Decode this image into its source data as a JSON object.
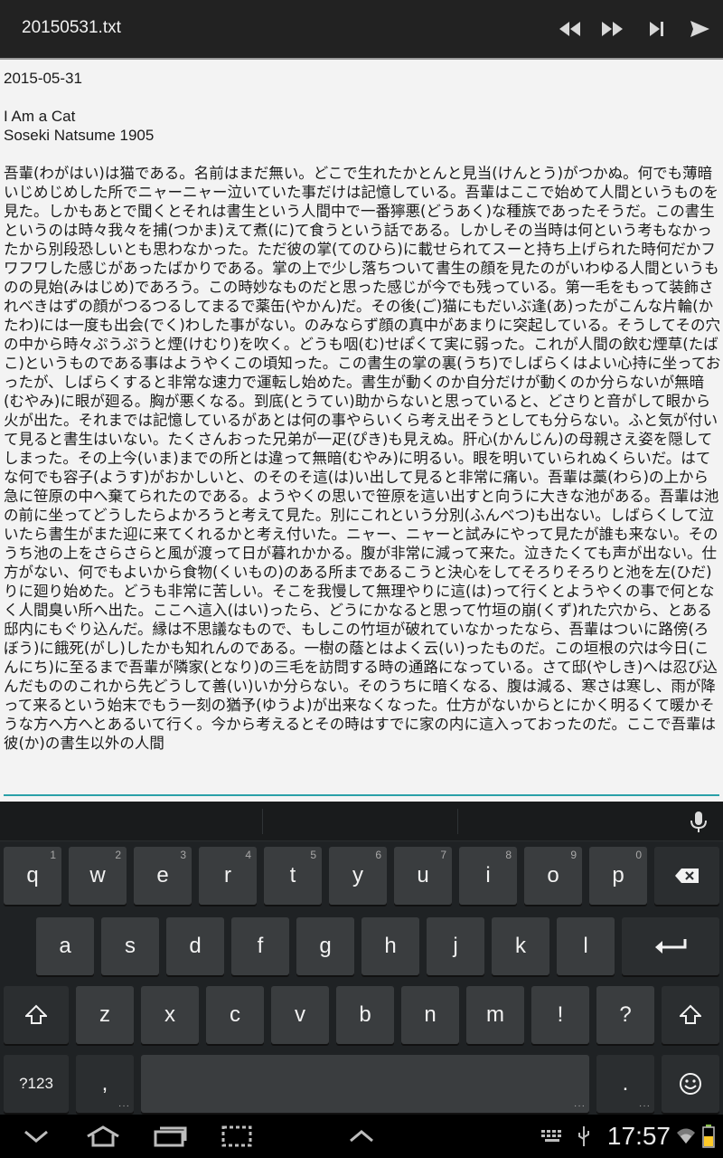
{
  "actionbar": {
    "title": "20150531.txt",
    "buttons": [
      "rewind-icon",
      "fast-forward-icon",
      "skip-next-icon",
      "send-icon"
    ]
  },
  "editor": {
    "date": "2015-05-31",
    "title_line1": "I Am a Cat",
    "title_line2": "Soseki Natsume 1905",
    "body": "吾輩(わがはい)は猫である。名前はまだ無い。どこで生れたかとんと見当(けんとう)がつかぬ。何でも薄暗いじめじめした所でニャーニャー泣いていた事だけは記憶している。吾輩はここで始めて人間というものを見た。しかもあとで聞くとそれは書生という人間中で一番獰悪(どうあく)な種族であったそうだ。この書生というのは時々我々を捕(つかま)えて煮(に)て食うという話である。しかしその当時は何という考もなかったから別段恐しいとも思わなかった。ただ彼の掌(てのひら)に載せられてスーと持ち上げられた時何だかフワフワした感じがあったばかりである。掌の上で少し落ちついて書生の顔を見たのがいわゆる人間というものの見始(みはじめ)であろう。この時妙なものだと思った感じが今でも残っている。第一毛をもって装飾されべきはずの顔がつるつるしてまるで薬缶(やかん)だ。その後(ご)猫にもだいぶ逢(あ)ったがこんな片輪(かたわ)には一度も出会(でく)わした事がない。のみならず顔の真中があまりに突起している。そうしてその穴の中から時々ぷうぷうと煙(けむり)を吹く。どうも咽(む)せぽくて実に弱った。これが人間の飲む煙草(たばこ)というものである事はようやくこの頃知った。この書生の掌の裏(うち)でしばらくはよい心持に坐っておったが、しばらくすると非常な速力で運転し始めた。書生が動くのか自分だけが動くのか分らないが無暗(むやみ)に眼が廻る。胸が悪くなる。到底(とうてい)助からないと思っていると、どさりと音がして眼から火が出た。それまでは記憶しているがあとは何の事やらいくら考え出そうとしても分らない。ふと気が付いて見ると書生はいない。たくさんおった兄弟が一疋(ぴき)も見えぬ。肝心(かんじん)の母親さえ姿を隠してしまった。その上今(いま)までの所とは違って無暗(むやみ)に明るい。眼を明いていられぬくらいだ。はてな何でも容子(ようす)がおかしいと、のそのそ這(は)い出して見ると非常に痛い。吾輩は藁(わら)の上から急に笹原の中へ棄てられたのである。ようやくの思いで笹原を這い出すと向うに大きな池がある。吾輩は池の前に坐ってどうしたらよかろうと考えて見た。別にこれという分別(ふんべつ)も出ない。しばらくして泣いたら書生がまた迎に来てくれるかと考え付いた。ニャー、ニャーと試みにやって見たが誰も来ない。そのうち池の上をさらさらと風が渡って日が暮れかかる。腹が非常に減って来た。泣きたくても声が出ない。仕方がない、何でもよいから食物(くいもの)のある所まであるこうと決心をしてそろりそろりと池を左(ひだ)りに廻り始めた。どうも非常に苦しい。そこを我慢して無理やりに這(は)って行くとようやくの事で何となく人間臭い所へ出た。ここへ這入(はい)ったら、どうにかなると思って竹垣の崩(くず)れた穴から、とある邸内にもぐり込んだ。縁は不思議なもので、もしこの竹垣が破れていなかったなら、吾輩はついに路傍(ろぼう)に餓死(がし)したかも知れんのである。一樹の蔭とはよく云(い)ったものだ。この垣根の穴は今日(こんにち)に至るまで吾輩が隣家(となり)の三毛を訪問する時の通路になっている。さて邸(やしき)へは忍び込んだもののこれから先どうして善(い)いか分らない。そのうちに暗くなる、腹は減る、寒さは寒し、雨が降って来るという始末でもう一刻の猶予(ゆうよ)が出来なくなった。仕方がないからとにかく明るくて暖かそうな方へ方へとあるいて行く。今から考えるとその時はすでに家の内に這入っておったのだ。ここで吾輩は彼(か)の書生以外の人間"
  },
  "keyboard": {
    "row1": [
      {
        "label": "q",
        "hint": "1"
      },
      {
        "label": "w",
        "hint": "2"
      },
      {
        "label": "e",
        "hint": "3"
      },
      {
        "label": "r",
        "hint": "4"
      },
      {
        "label": "t",
        "hint": "5"
      },
      {
        "label": "y",
        "hint": "6"
      },
      {
        "label": "u",
        "hint": "7"
      },
      {
        "label": "i",
        "hint": "8"
      },
      {
        "label": "o",
        "hint": "9"
      },
      {
        "label": "p",
        "hint": "0"
      }
    ],
    "row2": [
      "a",
      "s",
      "d",
      "f",
      "g",
      "h",
      "j",
      "k",
      "l"
    ],
    "row3": [
      "z",
      "x",
      "c",
      "v",
      "b",
      "n",
      "m",
      "!",
      "?"
    ],
    "symbols_label": "?123",
    "comma_label": ",",
    "period_label": ".",
    "icons": [
      "mic-icon",
      "backspace-icon",
      "enter-icon",
      "shift-icon",
      "emoji-icon"
    ]
  },
  "navbar": {
    "clock": "17:57",
    "icons": [
      "back-icon",
      "home-icon",
      "recents-icon",
      "screenshot-icon",
      "menu-up-icon",
      "keyboard-icon",
      "usb-icon",
      "wifi-icon",
      "battery-icon"
    ]
  }
}
